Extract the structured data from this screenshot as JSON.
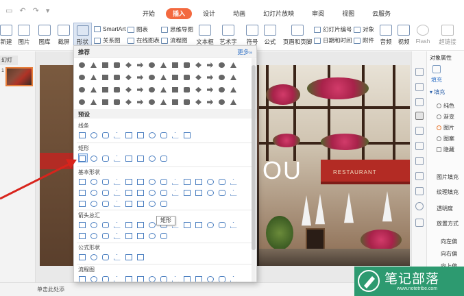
{
  "menu": {
    "tabs": [
      {
        "label": "开始"
      },
      {
        "label": "插入"
      },
      {
        "label": "设计"
      },
      {
        "label": "动画"
      },
      {
        "label": "幻灯片放映"
      },
      {
        "label": "审阅"
      },
      {
        "label": "视图"
      },
      {
        "label": "云服务"
      }
    ],
    "active_tab": "插入",
    "accent_color": "#f3693f"
  },
  "ribbon": {
    "new_slide": "新建",
    "picture": "图片",
    "gallery": "图库",
    "screenshot": "截屏",
    "shapes": "形状",
    "smartart": "SmartArt",
    "relation_chart": "关系图",
    "chart": "图表",
    "online_chart": "在线图表",
    "mind_map": "思维导图",
    "flowchart": "流程图",
    "textbox": "文本框",
    "wordart": "艺术字",
    "symbol": "符号",
    "formula": "公式",
    "header_footer": "页眉和页脚",
    "slide_number": "幻灯片编号",
    "datetime": "日期和时间",
    "object": "对象",
    "attachment": "附件",
    "audio": "音频",
    "video": "视频",
    "flash": "Flash",
    "hyperlink": "超链接"
  },
  "left_panel": {
    "tab_label": "幻灯",
    "slide_number": "1"
  },
  "shapes_dropdown": {
    "recommended_label": "推荐",
    "more_label": "更多»",
    "preset_label": "预设",
    "categories": {
      "lines": "线条",
      "rectangles": "矩形",
      "basic": "基本形状",
      "arrows": "箭头总汇",
      "formula": "公式形状",
      "flowchart": "流程图"
    },
    "tooltip": "矩形"
  },
  "slide": {
    "text": "OU",
    "sign": "RESTAURANT"
  },
  "right_pane": {
    "title": "对象属性",
    "fill_tab": "填充",
    "fill_section": "填充",
    "options": [
      "纯色",
      "渐变",
      "图片",
      "图案"
    ],
    "selected_option": "图片",
    "hide_bg": "隐藏",
    "picture_fill": "图片填充",
    "tile": "纹理填充",
    "transparency": "透明度",
    "placement": "放置方式",
    "offset_left": "向左偏",
    "offset_right": "向右偏",
    "offset_up": "向上偏"
  },
  "status_bar": {
    "notes_hint": "单击此处添"
  },
  "watermark": {
    "brand": "笔记部落",
    "url": "www.notetribe.com"
  }
}
